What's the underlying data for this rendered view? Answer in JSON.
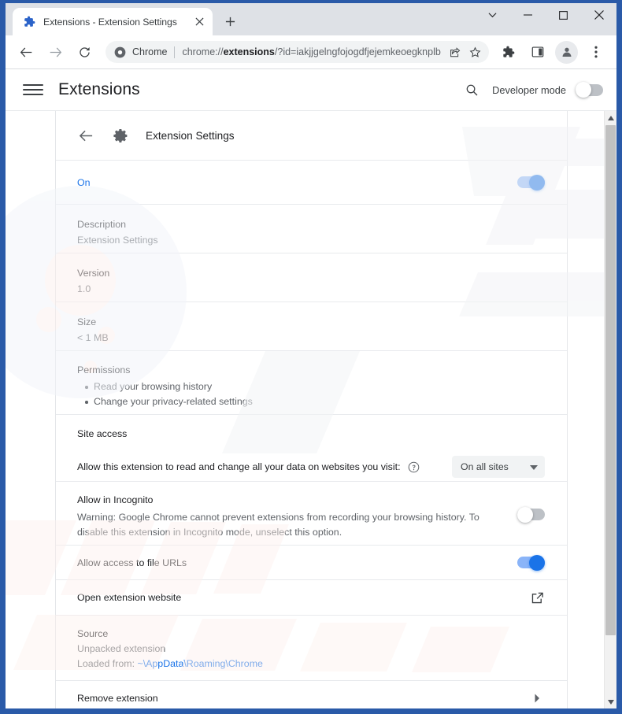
{
  "window": {
    "controls": {
      "chevron_down": "⌄",
      "minimize": "–",
      "maximize": "□",
      "close": "✕"
    }
  },
  "tab": {
    "title": "Extensions - Extension Settings",
    "favicon": "puzzle-piece-icon",
    "close": "✕",
    "new_tab": "+"
  },
  "toolbar": {
    "back": "←",
    "forward": "→",
    "reload": "⟳",
    "omnibox": {
      "chip": "Chrome",
      "url_prefix": "chrome://",
      "url_bold": "extensions",
      "url_suffix": "/?id=iakjjgelngfojogdfjejemkeoegknplb",
      "full_url": "chrome://extensions/?id=iakjjgelngfojogdfjejemkeoegknplb",
      "share_icon": "share-icon",
      "bookmark_icon": "star-icon"
    },
    "extensions_icon": "puzzle-piece-icon",
    "side_panel_icon": "side-panel-icon",
    "profile_icon": "avatar-icon",
    "menu_icon": "three-dot-menu-icon"
  },
  "ext_header": {
    "menu": "hamburger-icon",
    "title": "Extensions",
    "search_icon": "search-icon",
    "developer_mode_label": "Developer mode",
    "developer_mode_on": false
  },
  "detail": {
    "back_icon": "back-arrow-icon",
    "icon": "gear-icon",
    "title": "Extension Settings",
    "enabled_label": "On",
    "enabled": true,
    "description_label": "Description",
    "description_value": "Extension Settings",
    "version_label": "Version",
    "version_value": "1.0",
    "size_label": "Size",
    "size_value": "< 1 MB",
    "permissions_label": "Permissions",
    "permissions": [
      "Read your browsing history",
      "Change your privacy-related settings"
    ],
    "site_access_label": "Site access",
    "site_access_question": "Allow this extension to read and change all your data on websites you visit:",
    "help_icon": "help-circle-icon",
    "site_access_value": "On all sites",
    "site_access_caret": "caret-down-icon",
    "incognito_label": "Allow in Incognito",
    "incognito_warning": "Warning: Google Chrome cannot prevent extensions from recording your browsing history. To disable this extension in Incognito mode, unselect this option.",
    "incognito_on": false,
    "file_urls_label": "Allow access to file URLs",
    "file_urls_on": true,
    "open_website_label": "Open extension website",
    "open_website_icon": "external-link-icon",
    "source_label": "Source",
    "source_value": "Unpacked extension",
    "loaded_from_label": "Loaded from:",
    "loaded_from_path": "~\\AppData\\Roaming\\Chrome",
    "remove_label": "Remove extension",
    "remove_icon": "chevron-right-icon"
  },
  "colors": {
    "accent_blue": "#1a73e8",
    "toggle_track_on": "#8ab4f8",
    "toggle_track_off": "#bdc1c6",
    "window_frame": "#2a5aa8",
    "text_primary": "#202124",
    "text_secondary": "#5f6368"
  },
  "scrollbar": {
    "up_arrow": "▲",
    "down_arrow": "▼"
  }
}
